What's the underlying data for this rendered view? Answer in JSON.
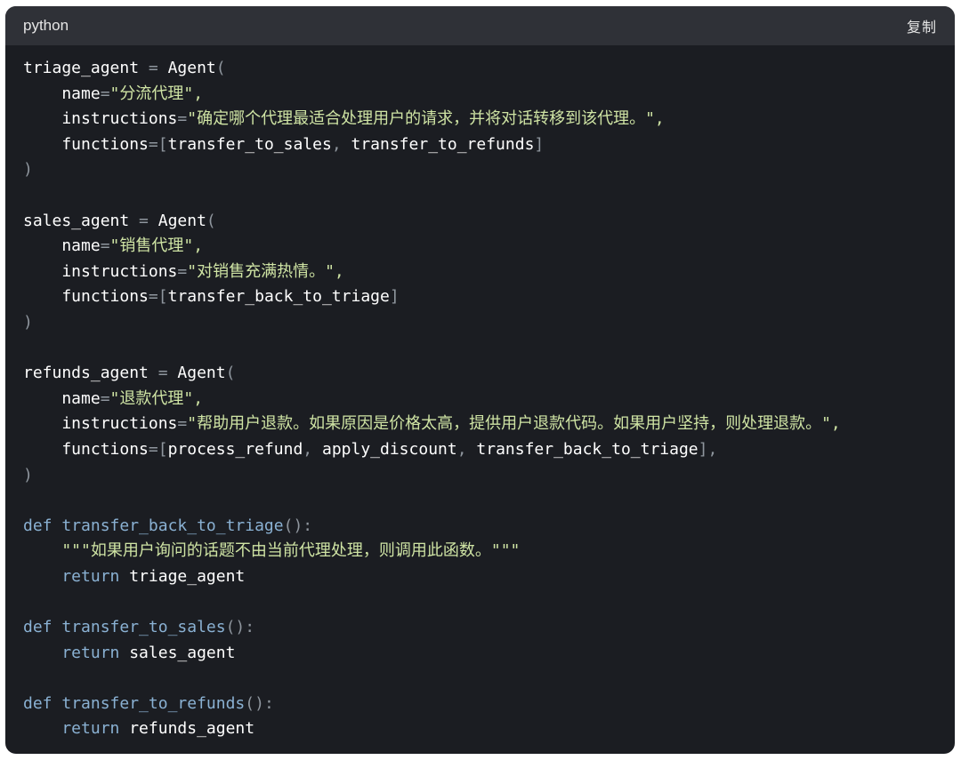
{
  "header": {
    "language": "python",
    "copy_label": "复制"
  },
  "colors": {
    "block_background": "#1b1d22",
    "header_background": "#2f3137",
    "identifier": "#ffffff",
    "operator": "#8f969e",
    "string": "#cfe4a4",
    "keyword": "#8ab1d3"
  },
  "code": {
    "lines": [
      [
        {
          "t": "triage_agent",
          "k": "ident"
        },
        {
          "t": " = ",
          "k": "op"
        },
        {
          "t": "Agent",
          "k": "ident"
        },
        {
          "t": "(",
          "k": "punct"
        }
      ],
      [
        {
          "t": "    name",
          "k": "ident"
        },
        {
          "t": "=",
          "k": "op"
        },
        {
          "t": "\"分流代理\",",
          "k": "string"
        }
      ],
      [
        {
          "t": "    instructions",
          "k": "ident"
        },
        {
          "t": "=",
          "k": "op"
        },
        {
          "t": "\"确定哪个代理最适合处理用户的请求，并将对话转移到该代理。\",",
          "k": "string"
        }
      ],
      [
        {
          "t": "    functions",
          "k": "ident"
        },
        {
          "t": "=[",
          "k": "op"
        },
        {
          "t": "transfer_to_sales",
          "k": "ident"
        },
        {
          "t": ", ",
          "k": "punct"
        },
        {
          "t": "transfer_to_refunds",
          "k": "ident"
        },
        {
          "t": "]",
          "k": "punct"
        }
      ],
      [
        {
          "t": ")",
          "k": "punct"
        }
      ],
      [],
      [
        {
          "t": "sales_agent",
          "k": "ident"
        },
        {
          "t": " = ",
          "k": "op"
        },
        {
          "t": "Agent",
          "k": "ident"
        },
        {
          "t": "(",
          "k": "punct"
        }
      ],
      [
        {
          "t": "    name",
          "k": "ident"
        },
        {
          "t": "=",
          "k": "op"
        },
        {
          "t": "\"销售代理\",",
          "k": "string"
        }
      ],
      [
        {
          "t": "    instructions",
          "k": "ident"
        },
        {
          "t": "=",
          "k": "op"
        },
        {
          "t": "\"对销售充满热情。\",",
          "k": "string"
        }
      ],
      [
        {
          "t": "    functions",
          "k": "ident"
        },
        {
          "t": "=[",
          "k": "op"
        },
        {
          "t": "transfer_back_to_triage",
          "k": "ident"
        },
        {
          "t": "]",
          "k": "punct"
        }
      ],
      [
        {
          "t": ")",
          "k": "punct"
        }
      ],
      [],
      [
        {
          "t": "refunds_agent",
          "k": "ident"
        },
        {
          "t": " = ",
          "k": "op"
        },
        {
          "t": "Agent",
          "k": "ident"
        },
        {
          "t": "(",
          "k": "punct"
        }
      ],
      [
        {
          "t": "    name",
          "k": "ident"
        },
        {
          "t": "=",
          "k": "op"
        },
        {
          "t": "\"退款代理\",",
          "k": "string"
        }
      ],
      [
        {
          "t": "    instructions",
          "k": "ident"
        },
        {
          "t": "=",
          "k": "op"
        },
        {
          "t": "\"帮助用户退款。如果原因是价格太高，提供用户退款代码。如果用户坚持，则处理退款。\",",
          "k": "string"
        }
      ],
      [
        {
          "t": "    functions",
          "k": "ident"
        },
        {
          "t": "=[",
          "k": "op"
        },
        {
          "t": "process_refund",
          "k": "ident"
        },
        {
          "t": ", ",
          "k": "punct"
        },
        {
          "t": "apply_discount",
          "k": "ident"
        },
        {
          "t": ", ",
          "k": "punct"
        },
        {
          "t": "transfer_back_to_triage",
          "k": "ident"
        },
        {
          "t": "],",
          "k": "punct"
        }
      ],
      [
        {
          "t": ")",
          "k": "punct"
        }
      ],
      [],
      [
        {
          "t": "def ",
          "k": "keyword"
        },
        {
          "t": "transfer_back_to_triage",
          "k": "func"
        },
        {
          "t": "():",
          "k": "punct"
        }
      ],
      [
        {
          "t": "    \"\"\"如果用户询问的话题不由当前代理处理，则调用此函数。\"\"\"",
          "k": "string"
        }
      ],
      [
        {
          "t": "    return ",
          "k": "keyword"
        },
        {
          "t": "triage_agent",
          "k": "ident"
        }
      ],
      [],
      [
        {
          "t": "def ",
          "k": "keyword"
        },
        {
          "t": "transfer_to_sales",
          "k": "func"
        },
        {
          "t": "():",
          "k": "punct"
        }
      ],
      [
        {
          "t": "    return ",
          "k": "keyword"
        },
        {
          "t": "sales_agent",
          "k": "ident"
        }
      ],
      [],
      [
        {
          "t": "def ",
          "k": "keyword"
        },
        {
          "t": "transfer_to_refunds",
          "k": "func"
        },
        {
          "t": "():",
          "k": "punct"
        }
      ],
      [
        {
          "t": "    return ",
          "k": "keyword"
        },
        {
          "t": "refunds_agent",
          "k": "ident"
        }
      ]
    ]
  }
}
